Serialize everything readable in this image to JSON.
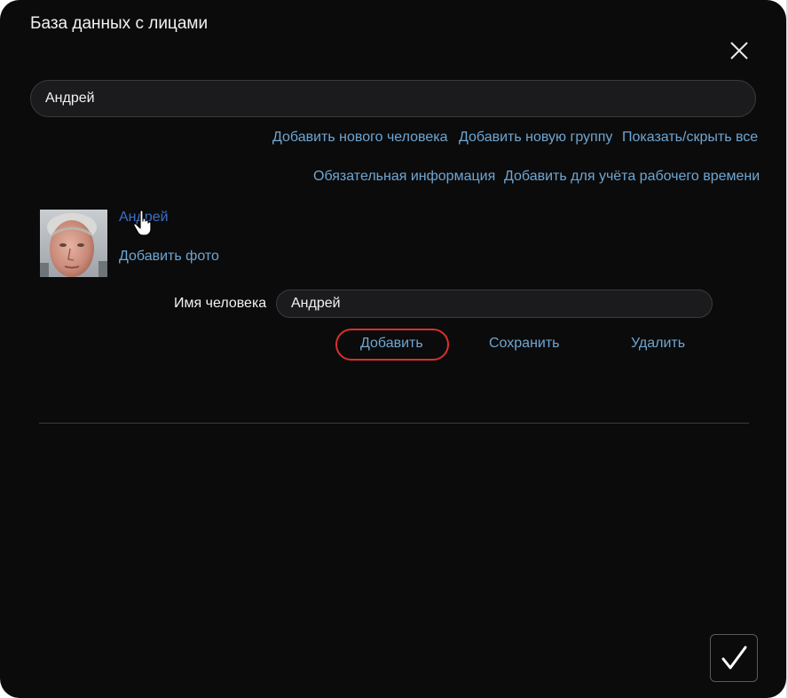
{
  "dialog": {
    "title": "База данных с лицами",
    "close_icon": "close-icon"
  },
  "search": {
    "value": "Андрей"
  },
  "actions": {
    "add_person": "Добавить нового человека",
    "add_group": "Добавить новую группу",
    "toggle_all": "Показать/скрыть все",
    "required_info": "Обязательная информация",
    "add_time_tracking": "Добавить для учёта рабочего времени"
  },
  "person": {
    "name_link": "Андрей",
    "add_photo": "Добавить фото",
    "field_label": "Имя человека",
    "name_value": "Андрей"
  },
  "buttons": {
    "add": "Добавить",
    "save": "Сохранить",
    "delete": "Удалить"
  },
  "colors": {
    "background": "#0b0b0c",
    "link": "#6fa6d1",
    "active_link": "#3d6fc7",
    "highlight": "#d8302c"
  },
  "confirm": {
    "icon": "checkmark-icon"
  }
}
